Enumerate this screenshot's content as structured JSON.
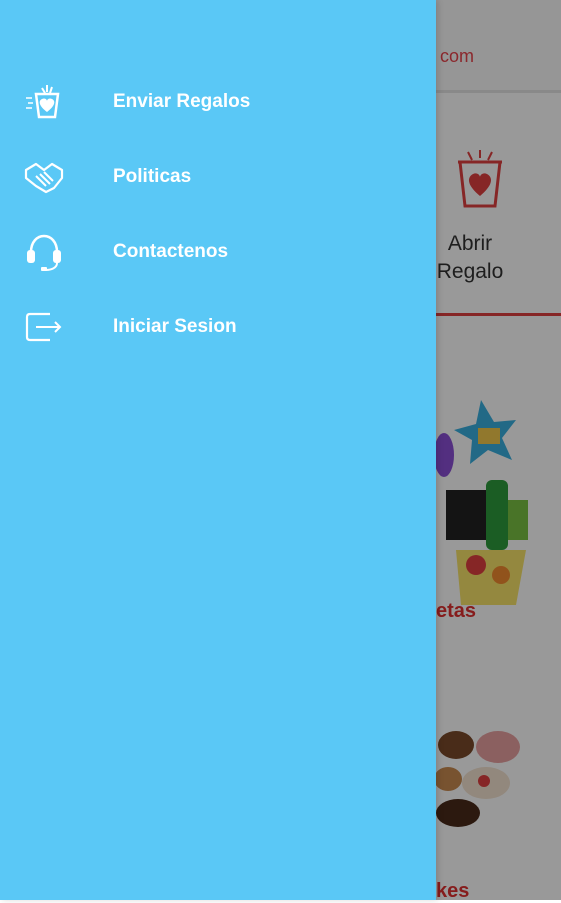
{
  "drawer": {
    "background": "#5ac8f6",
    "items": [
      {
        "label": "Enviar Regalos",
        "icon": "gift-heart-icon"
      },
      {
        "label": "Politicas",
        "icon": "handshake-icon"
      },
      {
        "label": "Contactenos",
        "icon": "headset-icon"
      },
      {
        "label": "Iniciar Sesion",
        "icon": "login-icon"
      }
    ]
  },
  "background_screen": {
    "header_brand": "com",
    "open_gift_label": "Abrir Regalo",
    "product_1_label": "etas",
    "product_2_label": "kes"
  },
  "colors": {
    "accent_red": "#e04040",
    "drawer_text": "#ffffff"
  }
}
